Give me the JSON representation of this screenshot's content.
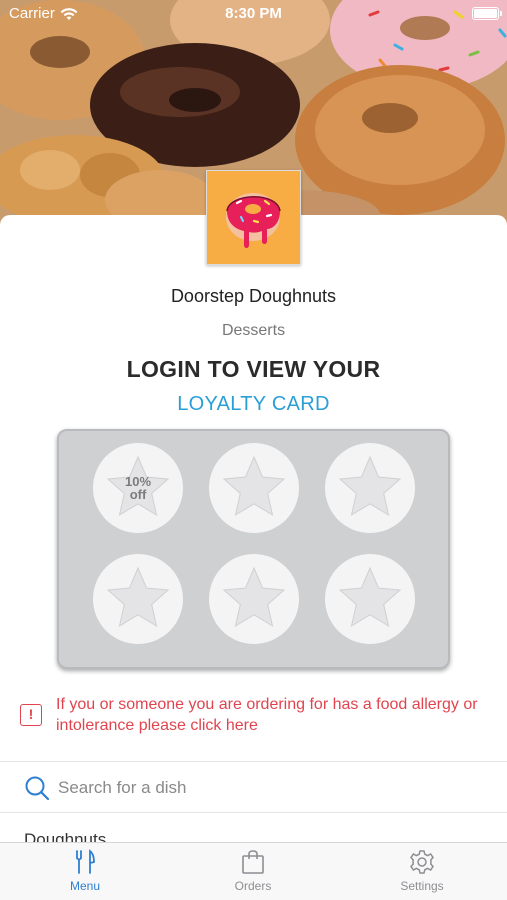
{
  "status_bar": {
    "carrier": "Carrier",
    "time": "8:30 PM"
  },
  "restaurant": {
    "name": "Doorstep Doughnuts",
    "category": "Desserts"
  },
  "loyalty": {
    "heading": "LOGIN TO VIEW YOUR",
    "link_label": "LOYALTY CARD",
    "stamps": [
      {
        "label": "10% off"
      },
      {
        "label": ""
      },
      {
        "label": ""
      },
      {
        "label": ""
      },
      {
        "label": ""
      },
      {
        "label": ""
      }
    ]
  },
  "allergy": {
    "icon": "!",
    "text": "If you or someone you are ordering for has a food allergy or intolerance please click here"
  },
  "search": {
    "placeholder": "Search for a dish"
  },
  "menu_section_peek": "Doughnuts",
  "tab_bar": {
    "items": [
      {
        "label": "Menu",
        "icon": "utensils-icon",
        "active": true
      },
      {
        "label": "Orders",
        "icon": "bag-icon",
        "active": false
      },
      {
        "label": "Settings",
        "icon": "gear-icon",
        "active": false
      }
    ]
  },
  "colors": {
    "accent": "#2a9fd6",
    "tab_active": "#2f7fd0",
    "tab_inactive": "#8e8e93",
    "alert": "#e0454f",
    "logo_bg": "#f7ad43"
  }
}
